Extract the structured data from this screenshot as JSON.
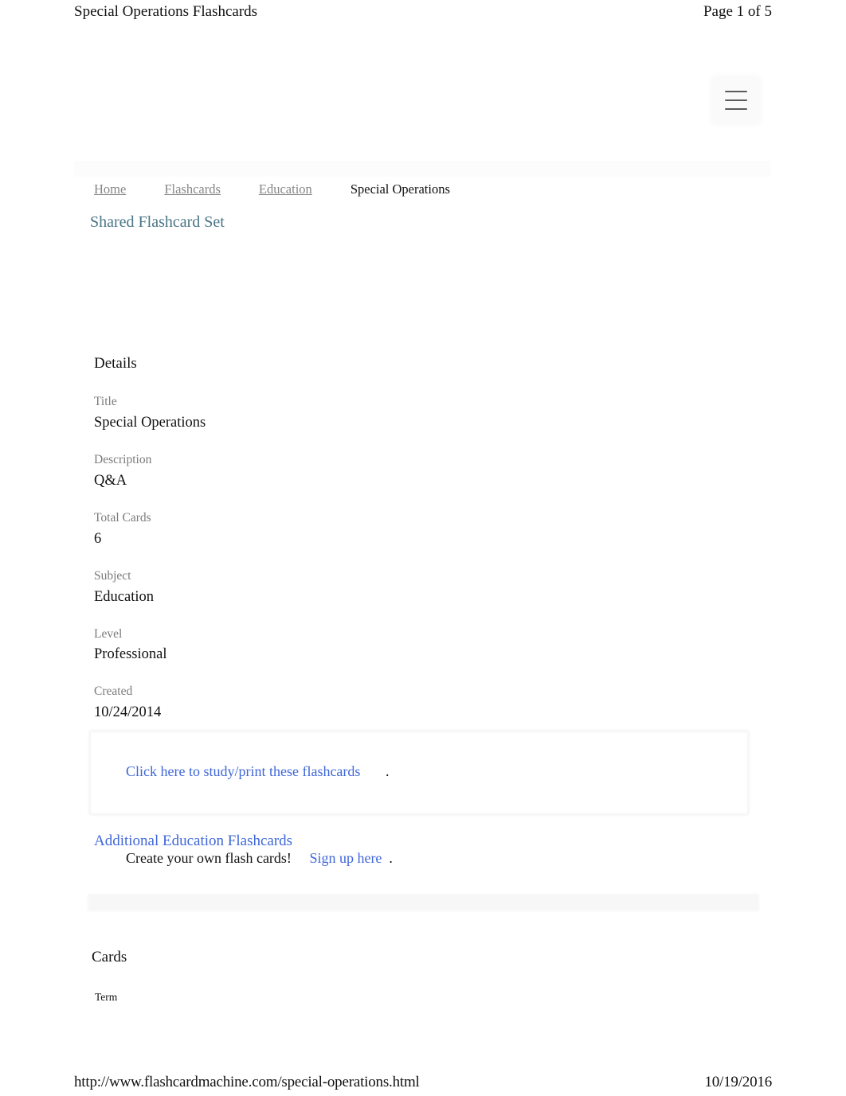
{
  "print": {
    "header_title": "Special Operations Flashcards",
    "page_indicator": "Page 1 of 5",
    "footer_url": "http://www.flashcardmachine.com/special-operations.html",
    "footer_date": "10/19/2016"
  },
  "colors": {
    "link_blue": "#3f67d8",
    "subtitle_teal": "#4a7585",
    "label_gray": "#7b7b7b",
    "text_black": "#111111"
  },
  "nav": {
    "menu_icon": "hamburger-menu-icon",
    "breadcrumb": [
      {
        "label": "Home",
        "current": false
      },
      {
        "label": "Flashcards",
        "current": false
      },
      {
        "label": "Education",
        "current": false
      },
      {
        "label": "Special Operations",
        "current": true
      }
    ]
  },
  "page": {
    "subtitle": "Shared Flashcard Set"
  },
  "details": {
    "heading": "Details",
    "fields": [
      {
        "label": "Title",
        "value": "Special Operations"
      },
      {
        "label": "Description",
        "value": "Q&A"
      },
      {
        "label": "Total Cards",
        "value": "6"
      },
      {
        "label": "Subject",
        "value": "Education"
      },
      {
        "label": "Level",
        "value": "Professional"
      },
      {
        "label": "Created",
        "value": "10/24/2014"
      }
    ]
  },
  "callout": {
    "study_link": "Click here to study/print these flashcards",
    "study_trailing": ".",
    "create_text": "Create your own flash cards!",
    "signup_link": "Sign up here",
    "signup_trailing": "."
  },
  "additional": {
    "link_label": "Additional Education Flashcards"
  },
  "cards": {
    "heading": "Cards",
    "term_label": "Term"
  }
}
